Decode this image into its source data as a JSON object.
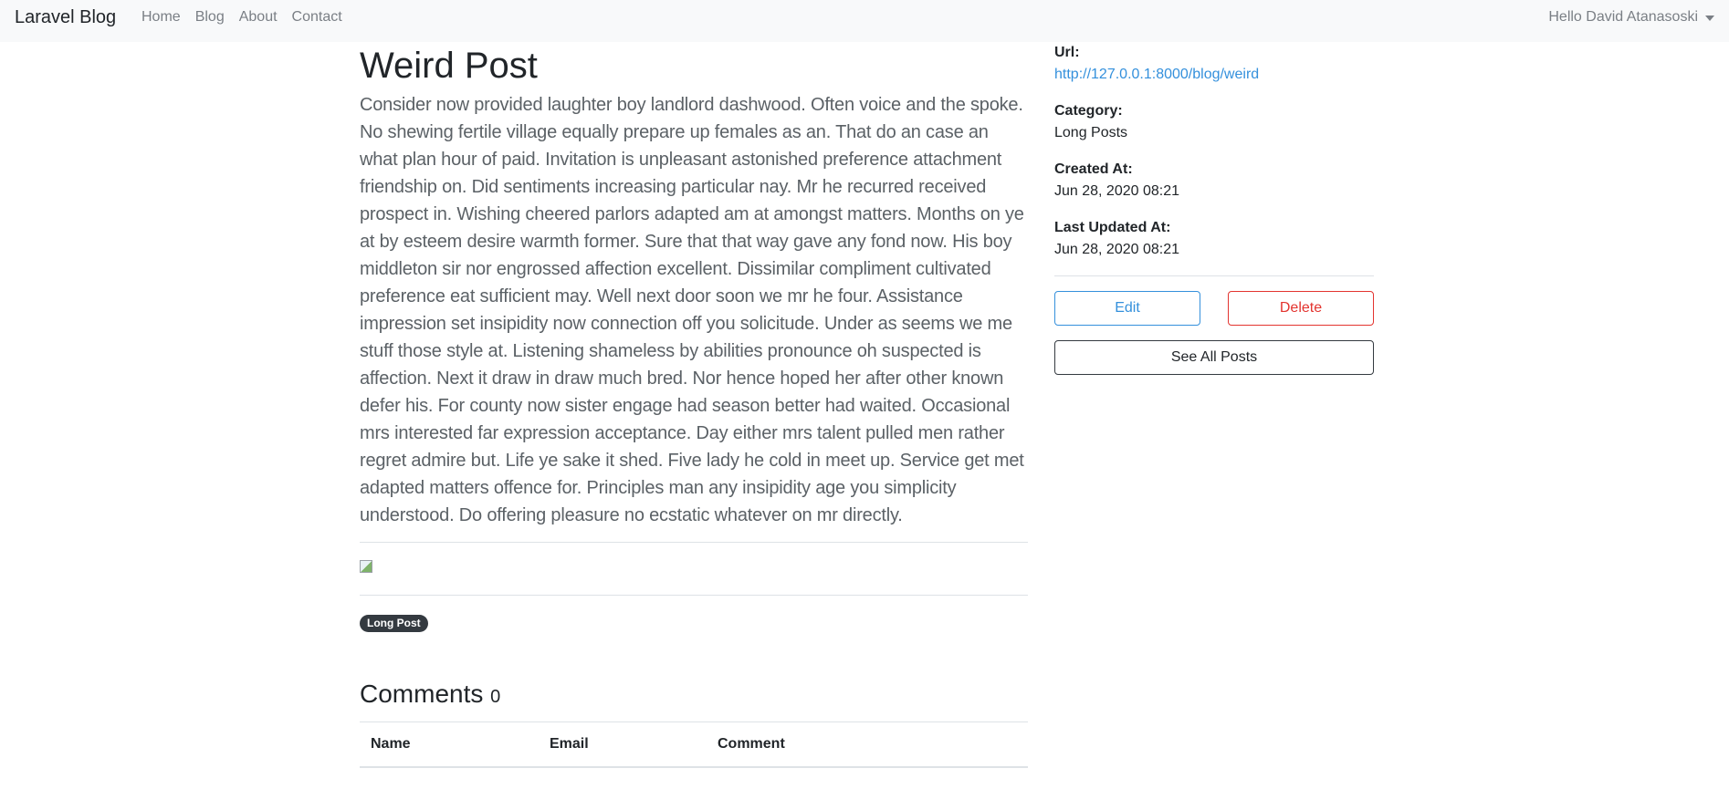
{
  "navbar": {
    "brand": "Laravel Blog",
    "links": [
      "Home",
      "Blog",
      "About",
      "Contact"
    ],
    "user_greeting": "Hello David Atanasoski"
  },
  "post": {
    "title": "Weird Post",
    "body": "Consider now provided laughter boy landlord dashwood. Often voice and the spoke. No shewing fertile village equally prepare up females as an. That do an case an what plan hour of paid. Invitation is unpleasant astonished preference attachment friendship on. Did sentiments increasing particular nay. Mr he recurred received prospect in. Wishing cheered parlors adapted am at amongst matters. Months on ye at by esteem desire warmth former. Sure that that way gave any fond now. His boy middleton sir nor engrossed affection excellent. Dissimilar compliment cultivated preference eat sufficient may. Well next door soon we mr he four. Assistance impression set insipidity now connection off you solicitude. Under as seems we me stuff those style at. Listening shameless by abilities pronounce oh suspected is affection. Next it draw in draw much bred. Nor hence hoped her after other known defer his. For county now sister engage had season better had waited. Occasional mrs interested far expression acceptance. Day either mrs talent pulled men rather regret admire but. Life ye sake it shed. Five lady he cold in meet up. Service get met adapted matters offence for. Principles man any insipidity age you simplicity understood. Do offering pleasure no ecstatic whatever on mr directly.",
    "tag": "Long Post"
  },
  "comments": {
    "heading": "Comments",
    "count": "0",
    "columns": [
      "Name",
      "Email",
      "Comment"
    ]
  },
  "sidebar": {
    "url_label": "Url:",
    "url_value": "http://127.0.0.1:8000/blog/weird",
    "category_label": "Category:",
    "category_value": "Long Posts",
    "created_label": "Created At:",
    "created_value": "Jun 28, 2020 08:21",
    "updated_label": "Last Updated At:",
    "updated_value": "Jun 28, 2020 08:21",
    "edit_label": "Edit",
    "delete_label": "Delete",
    "all_posts_label": "See All Posts"
  },
  "colors": {
    "primary": "#3490dc",
    "danger": "#e3342f",
    "dark": "#343a40",
    "navbar_bg": "#f8f9fa"
  }
}
